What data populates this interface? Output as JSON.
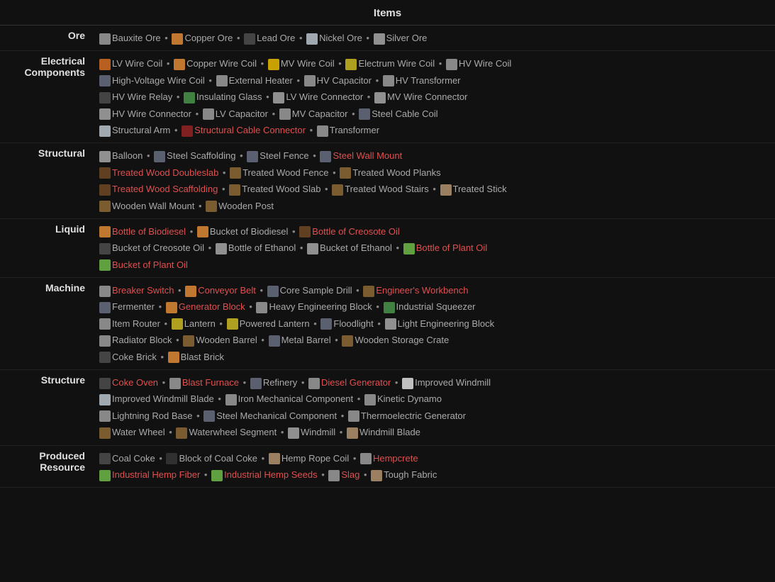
{
  "title": "Items",
  "categories": [
    {
      "id": "ore",
      "label": "Ore",
      "items": [
        {
          "name": "Bauxite Ore",
          "red": false,
          "icon": "ic-gray"
        },
        {
          "name": "Copper Ore",
          "red": false,
          "icon": "ic-orange"
        },
        {
          "name": "Lead Ore",
          "red": false,
          "icon": "ic-dark"
        },
        {
          "name": "Nickel Ore",
          "red": false,
          "icon": "ic-silver"
        },
        {
          "name": "Silver Ore",
          "red": false,
          "icon": "ic-light"
        }
      ]
    },
    {
      "id": "electrical",
      "label": "Electrical\nComponents",
      "items": [
        {
          "name": "LV Wire Coil",
          "red": false,
          "icon": "ic-copper"
        },
        {
          "name": "Copper Wire Coil",
          "red": false,
          "icon": "ic-orange"
        },
        {
          "name": "MV Wire Coil",
          "red": false,
          "icon": "ic-gold"
        },
        {
          "name": "Electrum Wire Coil",
          "red": false,
          "icon": "ic-yellow"
        },
        {
          "name": "HV Wire Coil",
          "red": false,
          "icon": "ic-gray"
        },
        {
          "name": "High-Voltage Wire Coil",
          "red": false,
          "icon": "ic-steel"
        },
        {
          "name": "External Heater",
          "red": false,
          "icon": "ic-gray"
        },
        {
          "name": "HV Capacitor",
          "red": false,
          "icon": "ic-gray"
        },
        {
          "name": "HV Transformer",
          "red": false,
          "icon": "ic-gray"
        },
        {
          "name": "HV Wire Relay",
          "red": false,
          "icon": "ic-dark"
        },
        {
          "name": "Insulating Glass",
          "red": false,
          "icon": "ic-green"
        },
        {
          "name": "LV Wire Connector",
          "red": false,
          "icon": "ic-light"
        },
        {
          "name": "MV Wire Connector",
          "red": false,
          "icon": "ic-light"
        },
        {
          "name": "HV Wire Connector",
          "red": false,
          "icon": "ic-light"
        },
        {
          "name": "LV Capacitor",
          "red": false,
          "icon": "ic-gray"
        },
        {
          "name": "MV Capacitor",
          "red": false,
          "icon": "ic-gray"
        },
        {
          "name": "Steel Cable Coil",
          "red": false,
          "icon": "ic-steel"
        },
        {
          "name": "Structural Arm",
          "red": false,
          "icon": "ic-silver"
        },
        {
          "name": "Structural Cable Connector",
          "red": true,
          "icon": "ic-red"
        },
        {
          "name": "Transformer",
          "red": false,
          "icon": "ic-gray"
        }
      ]
    },
    {
      "id": "structural",
      "label": "Structural",
      "items": [
        {
          "name": "Balloon",
          "red": false,
          "icon": "ic-light"
        },
        {
          "name": "Steel Scaffolding",
          "red": false,
          "icon": "ic-steel"
        },
        {
          "name": "Steel Fence",
          "red": false,
          "icon": "ic-steel"
        },
        {
          "name": "Steel Wall Mount",
          "red": true,
          "icon": "ic-steel"
        },
        {
          "name": "Treated Wood Doubleslab",
          "red": true,
          "icon": "ic-brown"
        },
        {
          "name": "Treated Wood Fence",
          "red": false,
          "icon": "ic-wood"
        },
        {
          "name": "Treated Wood Planks",
          "red": false,
          "icon": "ic-wood"
        },
        {
          "name": "Treated Wood Scaffolding",
          "red": true,
          "icon": "ic-brown"
        },
        {
          "name": "Treated Wood Slab",
          "red": false,
          "icon": "ic-wood"
        },
        {
          "name": "Treated Wood Stairs",
          "red": false,
          "icon": "ic-wood"
        },
        {
          "name": "Treated Stick",
          "red": false,
          "icon": "ic-tan"
        },
        {
          "name": "Wooden Wall Mount",
          "red": false,
          "icon": "ic-wood"
        },
        {
          "name": "Wooden Post",
          "red": false,
          "icon": "ic-wood"
        }
      ]
    },
    {
      "id": "liquid",
      "label": "Liquid",
      "items": [
        {
          "name": "Bottle of Biodiesel",
          "red": true,
          "icon": "ic-orange"
        },
        {
          "name": "Bucket of Biodiesel",
          "red": false,
          "icon": "ic-orange"
        },
        {
          "name": "Bottle of Creosote Oil",
          "red": true,
          "icon": "ic-brown"
        },
        {
          "name": "Bucket of Creosote Oil",
          "red": false,
          "icon": "ic-dark"
        },
        {
          "name": "Bottle of Ethanol",
          "red": false,
          "icon": "ic-light"
        },
        {
          "name": "Bucket of Ethanol",
          "red": false,
          "icon": "ic-light"
        },
        {
          "name": "Bottle of Plant Oil",
          "red": true,
          "icon": "ic-lime"
        },
        {
          "name": "Bucket of Plant Oil",
          "red": true,
          "icon": "ic-lime"
        }
      ]
    },
    {
      "id": "machine",
      "label": "Machine",
      "items": [
        {
          "name": "Breaker Switch",
          "red": true,
          "icon": "ic-gray"
        },
        {
          "name": "Conveyor Belt",
          "red": true,
          "icon": "ic-orange"
        },
        {
          "name": "Core Sample Drill",
          "red": false,
          "icon": "ic-steel"
        },
        {
          "name": "Engineer's Workbench",
          "red": true,
          "icon": "ic-wood"
        },
        {
          "name": "Fermenter",
          "red": false,
          "icon": "ic-steel"
        },
        {
          "name": "Generator Block",
          "red": true,
          "icon": "ic-orange"
        },
        {
          "name": "Heavy Engineering Block",
          "red": false,
          "icon": "ic-gray"
        },
        {
          "name": "Industrial Squeezer",
          "red": false,
          "icon": "ic-green"
        },
        {
          "name": "Item Router",
          "red": false,
          "icon": "ic-gray"
        },
        {
          "name": "Lantern",
          "red": false,
          "icon": "ic-yellow"
        },
        {
          "name": "Powered Lantern",
          "red": false,
          "icon": "ic-yellow"
        },
        {
          "name": "Floodlight",
          "red": false,
          "icon": "ic-steel"
        },
        {
          "name": "Light Engineering Block",
          "red": false,
          "icon": "ic-light"
        },
        {
          "name": "Radiator Block",
          "red": false,
          "icon": "ic-gray"
        },
        {
          "name": "Wooden Barrel",
          "red": false,
          "icon": "ic-wood"
        },
        {
          "name": "Metal Barrel",
          "red": false,
          "icon": "ic-steel"
        },
        {
          "name": "Wooden Storage Crate",
          "red": false,
          "icon": "ic-wood"
        },
        {
          "name": "Coke Brick",
          "red": false,
          "icon": "ic-dark"
        },
        {
          "name": "Blast Brick",
          "red": false,
          "icon": "ic-orange"
        }
      ]
    },
    {
      "id": "structure",
      "label": "Structure",
      "items": [
        {
          "name": "Coke Oven",
          "red": true,
          "icon": "ic-dark"
        },
        {
          "name": "Blast Furnace",
          "red": true,
          "icon": "ic-gray"
        },
        {
          "name": "Refinery",
          "red": false,
          "icon": "ic-steel"
        },
        {
          "name": "Diesel Generator",
          "red": true,
          "icon": "ic-gray"
        },
        {
          "name": "Improved Windmill",
          "red": false,
          "icon": "ic-white"
        },
        {
          "name": "Improved Windmill Blade",
          "red": false,
          "icon": "ic-silver"
        },
        {
          "name": "Iron Mechanical Component",
          "red": false,
          "icon": "ic-gray"
        },
        {
          "name": "Kinetic Dynamo",
          "red": false,
          "icon": "ic-gray"
        },
        {
          "name": "Lightning Rod Base",
          "red": false,
          "icon": "ic-gray"
        },
        {
          "name": "Steel Mechanical Component",
          "red": false,
          "icon": "ic-steel"
        },
        {
          "name": "Thermoelectric Generator",
          "red": false,
          "icon": "ic-gray"
        },
        {
          "name": "Water Wheel",
          "red": false,
          "icon": "ic-wood"
        },
        {
          "name": "Waterwheel Segment",
          "red": false,
          "icon": "ic-wood"
        },
        {
          "name": "Windmill",
          "red": false,
          "icon": "ic-light"
        },
        {
          "name": "Windmill Blade",
          "red": false,
          "icon": "ic-tan"
        }
      ]
    },
    {
      "id": "produced",
      "label": "Produced\nResource",
      "items": [
        {
          "name": "Coal Coke",
          "red": false,
          "icon": "ic-dark"
        },
        {
          "name": "Block of Coal Coke",
          "red": false,
          "icon": "ic-black"
        },
        {
          "name": "Hemp Rope Coil",
          "red": false,
          "icon": "ic-tan"
        },
        {
          "name": "Hempcrete",
          "red": true,
          "icon": "ic-gray"
        },
        {
          "name": "Industrial Hemp Fiber",
          "red": true,
          "icon": "ic-lime"
        },
        {
          "name": "Industrial Hemp Seeds",
          "red": true,
          "icon": "ic-lime"
        },
        {
          "name": "Slag",
          "red": true,
          "icon": "ic-gray"
        },
        {
          "name": "Tough Fabric",
          "red": false,
          "icon": "ic-tan"
        }
      ]
    }
  ]
}
